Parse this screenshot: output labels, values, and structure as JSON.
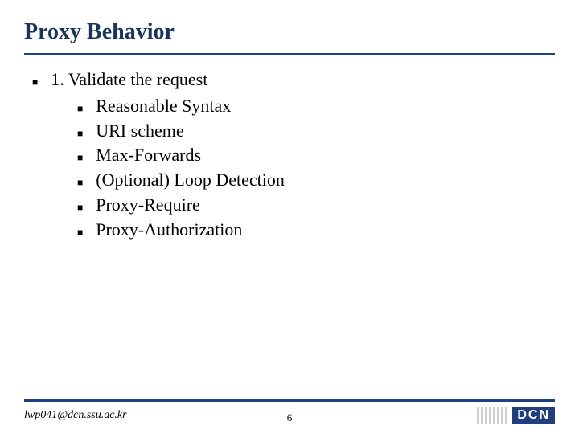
{
  "title": "Proxy Behavior",
  "main": {
    "heading": "1. Validate the request",
    "items": [
      "Reasonable Syntax",
      "URI scheme",
      "Max-Forwards",
      "(Optional) Loop Detection",
      "Proxy-Require",
      "Proxy-Authorization"
    ]
  },
  "footer": {
    "email": "lwp041@dcn.ssu.ac.kr",
    "page": "6",
    "logo_text": "DCN"
  },
  "glyphs": {
    "square": "■"
  }
}
